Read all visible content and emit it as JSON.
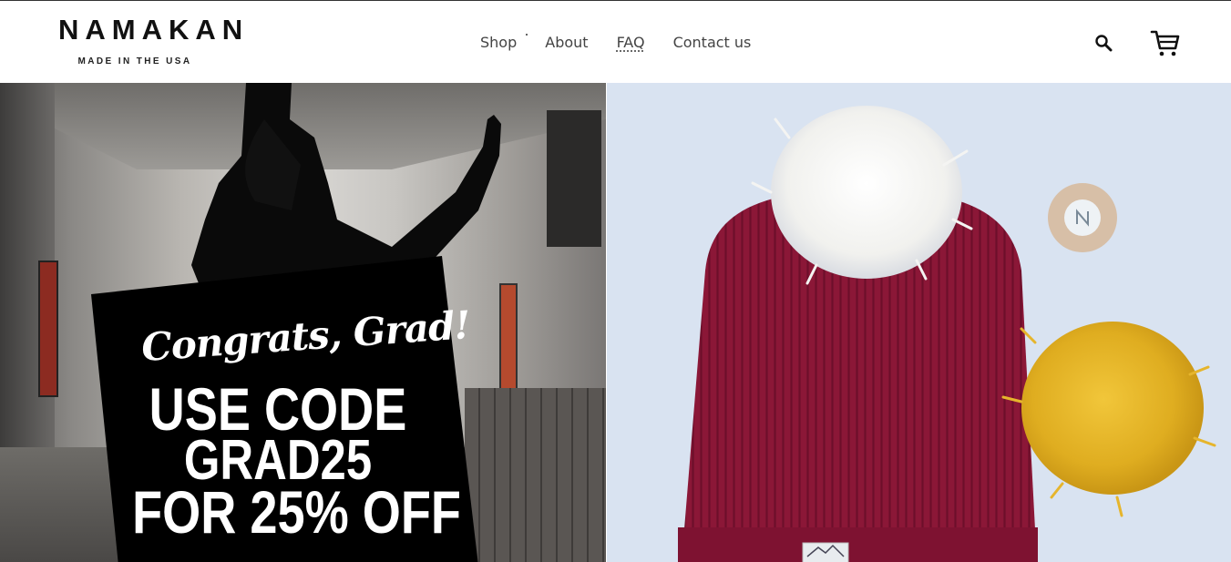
{
  "brand": {
    "name": "NAMAKAN",
    "tagline": "MADE IN THE USA"
  },
  "nav": {
    "items": [
      {
        "label": "Shop"
      },
      {
        "label": "About"
      },
      {
        "label": "FAQ"
      },
      {
        "label": "Contact us"
      }
    ]
  },
  "header_icons": {
    "search": "search-icon",
    "cart": "cart-icon"
  },
  "hero_left": {
    "headline": "Congrats, Grad!",
    "line1": "USE CODE",
    "line2": "GRAD25",
    "line3": "FOR 25% OFF"
  },
  "hero_right": {
    "subject": "beanie-with-pom-poms"
  },
  "colors": {
    "beanie": "#8b1737",
    "pom_yellow": "#e5b62a",
    "background_right": "#d9e3f1",
    "promo_card": "#000000"
  }
}
